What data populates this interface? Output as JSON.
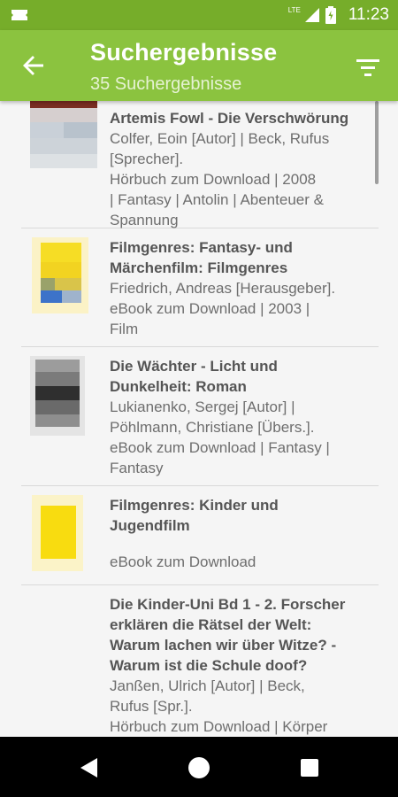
{
  "status_bar": {
    "time": "11:23",
    "network": "LTE",
    "icons": [
      "notification-icon",
      "signal-icon",
      "battery-icon"
    ]
  },
  "app_bar": {
    "title": "Suchergebnisse",
    "subtitle": "35 Suchergebnisse",
    "back_icon": "arrow-back-icon",
    "filter_icon": "filter-icon"
  },
  "results": [
    {
      "title": "Artemis Fowl - Die Verschwörung",
      "lines": [
        "Colfer, Eoin [Autor] | Beck, Rufus",
        "[Sprecher].",
        "Hörbuch zum Download | 2008",
        "| Fantasy | Antolin | Abenteuer &",
        "Spannung"
      ]
    },
    {
      "title_lines": [
        "Filmgenres: Fantasy- und",
        "Märchenfilm: Filmgenres"
      ],
      "lines": [
        "Friedrich, Andreas [Herausgeber].",
        "eBook zum Download | 2003 |",
        "Film"
      ]
    },
    {
      "title_lines": [
        "Die Wächter - Licht und",
        "Dunkelheit: Roman"
      ],
      "lines": [
        "Lukianenko, Sergej [Autor] |",
        "Pöhlmann, Christiane [Übers.].",
        "eBook zum Download | Fantasy |",
        "Fantasy"
      ]
    },
    {
      "title_lines": [
        "Filmgenres: Kinder und",
        "Jugendfilm"
      ],
      "lines": [
        "eBook zum Download"
      ]
    },
    {
      "title_lines": [
        "Die Kinder-Uni Bd 1 - 2. Forscher",
        "erklären die Rätsel der Welt:",
        "Warum lachen wir über Witze? -",
        "Warum ist die Schule doof?"
      ],
      "lines": [
        "Janßen, Ulrich [Autor] | Beck,",
        "Rufus [Spr.].",
        "Hörbuch zum Download | Körper"
      ]
    }
  ],
  "nav_bar": {
    "icons": [
      "nav-back-icon",
      "nav-home-icon",
      "nav-recents-icon"
    ]
  },
  "colors": {
    "status_bar": "#76ad2a",
    "app_bar": "#8bc33f",
    "title_text": "#555555",
    "meta_text": "#6e6e6e"
  }
}
